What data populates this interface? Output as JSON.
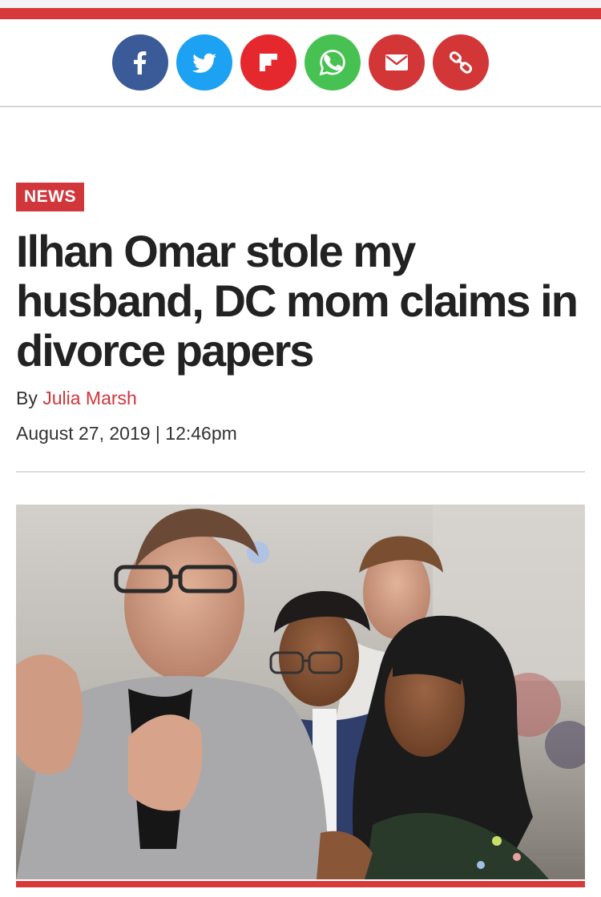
{
  "share": {
    "buttons": [
      {
        "name": "facebook-share-button",
        "icon": "facebook-icon",
        "color": "#3a5a98"
      },
      {
        "name": "twitter-share-button",
        "icon": "twitter-icon",
        "color": "#1da1f2"
      },
      {
        "name": "flipboard-share-button",
        "icon": "flipboard-icon",
        "color": "#e5282d"
      },
      {
        "name": "whatsapp-share-button",
        "icon": "whatsapp-icon",
        "color": "#47c252"
      },
      {
        "name": "email-share-button",
        "icon": "envelope-icon",
        "color": "#d33637"
      },
      {
        "name": "copy-link-button",
        "icon": "link-icon",
        "color": "#d33637"
      }
    ]
  },
  "article": {
    "section": "NEWS",
    "headline": "Ilhan Omar stole my husband, DC mom claims in divorce papers",
    "byline_prefix": "By",
    "author": "Julia Marsh",
    "date": "August 27, 2019",
    "date_sep": "|",
    "time": "12:46pm"
  },
  "photo": {
    "description_icon": "photo-people-clapping"
  },
  "colors": {
    "brand_red": "#d0363a",
    "text": "#222222"
  }
}
